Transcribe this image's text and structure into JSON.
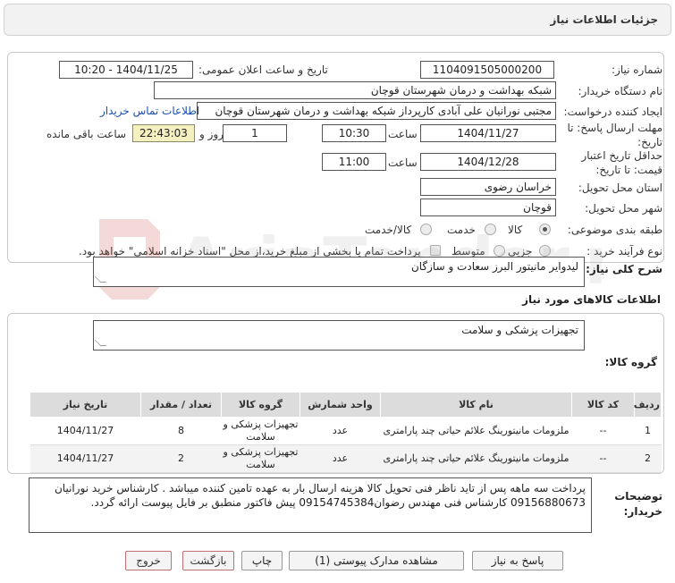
{
  "header": {
    "title": "جزئیات اطلاعات نیاز"
  },
  "fields": {
    "need_number_label": "شماره نیاز:",
    "need_number": "1104091505000200",
    "announce_label": "تاریخ و ساعت اعلان عمومی:",
    "announce_value": "1404/11/25 - 10:20",
    "buyer_org_label": "نام دستگاه خریدار:",
    "buyer_org": "شبکه بهداشت و درمان شهرستان قوچان",
    "creator_label": "ایجاد کننده درخواست:",
    "creator": "مجتبی نورانیان علی آبادی کارپرداز شبکه بهداشت و درمان شهرستان قوچان",
    "contact_link": "اطلاعات تماس خریدار",
    "deadline_label": "مهلت ارسال پاسخ: تا تاریخ:",
    "deadline_date": "1404/11/27",
    "time_word": "ساعت",
    "deadline_time": "10:30",
    "days_value": "1",
    "days_and": "روز و",
    "remaining_time": "22:43:03",
    "remaining_label": "ساعت باقی مانده",
    "validity_label": "حداقل تاریخ اعتبار قیمت: تا تاریخ:",
    "validity_date": "1404/12/28",
    "validity_time": "11:00",
    "province_label": "استان محل تحویل:",
    "province": "خراسان رضوی",
    "city_label": "شهر محل تحویل:",
    "city": "قوچان",
    "category_label": "طبقه بندی موضوعی:",
    "category_options": [
      "کالا",
      "خدمت",
      "کالا/خدمت"
    ],
    "process_label": "نوع فرآیند خرید :",
    "process_options": [
      "جزیی",
      "متوسط"
    ],
    "payment_note": "پرداخت تمام یا بخشی از مبلغ خرید،از محل \"اسناد خزانه اسلامی\" خواهد بود."
  },
  "summary": {
    "label": "شرح کلی نیاز:",
    "text": "لیدوایر مانیتور البرز سعادت و سازگان"
  },
  "goods_section": {
    "title": "اطلاعات کالاهای مورد نیاز",
    "group_label": "گروه کالا:",
    "group_value": "تجهیزات پزشکی و سلامت"
  },
  "table": {
    "headers": [
      "ردیف",
      "کد کالا",
      "نام کالا",
      "واحد شمارش",
      "گروه کالا",
      "تعداد / مقدار",
      "تاریخ نیاز"
    ],
    "rows": [
      [
        "1",
        "--",
        "ملزومات مانیتورینگ علائم حیاتی چند پارامتری",
        "عدد",
        "تجهیزات پزشکی و سلامت",
        "8",
        "1404/11/27"
      ],
      [
        "2",
        "--",
        "ملزومات مانیتورینگ علائم حیاتی چند پارامتری",
        "عدد",
        "تجهیزات پزشکی و سلامت",
        "2",
        "1404/11/27"
      ]
    ]
  },
  "buyer_notes": {
    "label": "توضیحات خریدار:",
    "text": "پرداخت سه ماهه پس از تاید ناظر فنی تحویل کالا هزینه ارسال بار به عهده تامین کننده میباشد . کارشناس خرید نورانیان 09156880673 کارشناس فنی مهندس رضوان09154745384 پیش فاکتور  منطبق بر  فایل پیوست ارائه گردد."
  },
  "buttons": {
    "reply": "پاسخ به نیاز",
    "attachments": "مشاهده مدارک پیوستی (1)",
    "print": "چاپ",
    "back": "بازگشت",
    "exit": "خروج"
  },
  "watermark": {
    "text": "AriaTender.net"
  }
}
